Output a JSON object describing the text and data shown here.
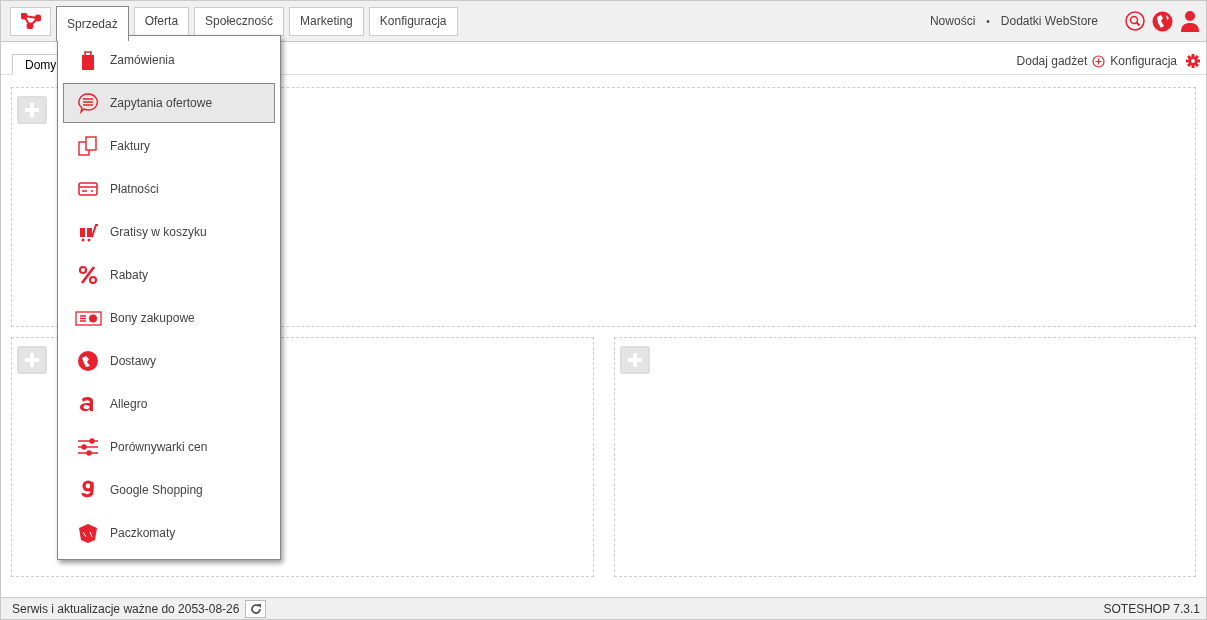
{
  "nav": {
    "items": [
      {
        "label": "Sprzedaż",
        "selected": true
      },
      {
        "label": "Oferta",
        "selected": false
      },
      {
        "label": "Społeczność",
        "selected": false
      },
      {
        "label": "Marketing",
        "selected": false
      },
      {
        "label": "Konfiguracja",
        "selected": false
      }
    ],
    "links": [
      "Nowości",
      "Dodatki WebStore"
    ],
    "separator": "•"
  },
  "menu": [
    {
      "label": "Zamówienia",
      "selected": false
    },
    {
      "label": "Zapytania ofertowe",
      "selected": true
    },
    {
      "label": "Faktury",
      "selected": false
    },
    {
      "label": "Płatności",
      "selected": false
    },
    {
      "label": "Gratisy w koszyku",
      "selected": false
    },
    {
      "label": "Rabaty",
      "selected": false
    },
    {
      "label": "Bony zakupowe",
      "selected": false
    },
    {
      "label": "Dostawy",
      "selected": false
    },
    {
      "label": "Allegro",
      "selected": false
    },
    {
      "label": "Porównywarki cen",
      "selected": false
    },
    {
      "label": "Google Shopping",
      "selected": false
    },
    {
      "label": "Paczkomaty",
      "selected": false
    }
  ],
  "tabs": [
    {
      "label": "Domy",
      "selected": true
    }
  ],
  "toolbar": {
    "add_gadget": "Dodaj gadżet",
    "configure": "Konfiguracja"
  },
  "status_bar": {
    "text": "Serwis i aktualizacje ważne do 2053-08-26",
    "version": "SOTESHOP 7.3.1"
  }
}
